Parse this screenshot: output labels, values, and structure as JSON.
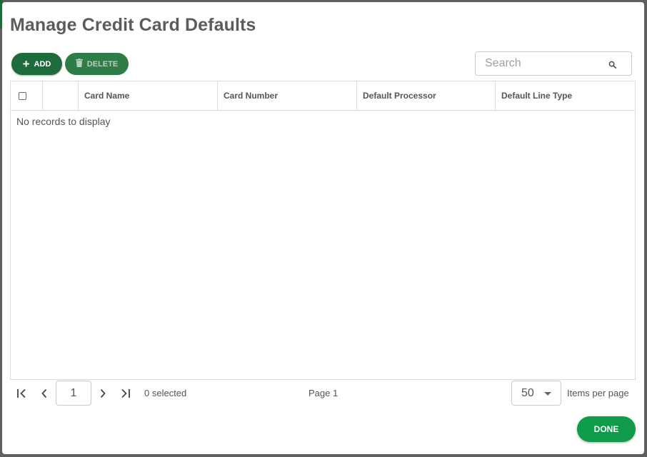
{
  "dialog": {
    "title": "Manage Credit Card Defaults"
  },
  "toolbar": {
    "add_label": "ADD",
    "delete_label": "DELETE",
    "search_placeholder": "Search",
    "search_value": ""
  },
  "grid": {
    "columns": [
      "",
      "",
      "Card Name",
      "Card Number",
      "Default Processor",
      "Default Line Type"
    ],
    "rows": [],
    "empty_message": "No records to display"
  },
  "pager": {
    "current_page": "1",
    "selected_text": "0 selected",
    "page_text": "Page 1",
    "items_per_page": "50",
    "items_per_page_label": "Items per page"
  },
  "footer": {
    "done_label": "DONE"
  },
  "colors": {
    "add_button": "#1e6b3d",
    "delete_button": "#2e7d47",
    "done_button": "#0e9c4a",
    "title_text": "#5c5c5c"
  },
  "icons": {
    "add": "plus-icon",
    "delete": "trash-icon",
    "search": "search-icon",
    "first_page": "first-page-icon",
    "prev_page": "chevron-left-icon",
    "next_page": "chevron-right-icon",
    "last_page": "last-page-icon",
    "dropdown": "caret-down-icon"
  }
}
